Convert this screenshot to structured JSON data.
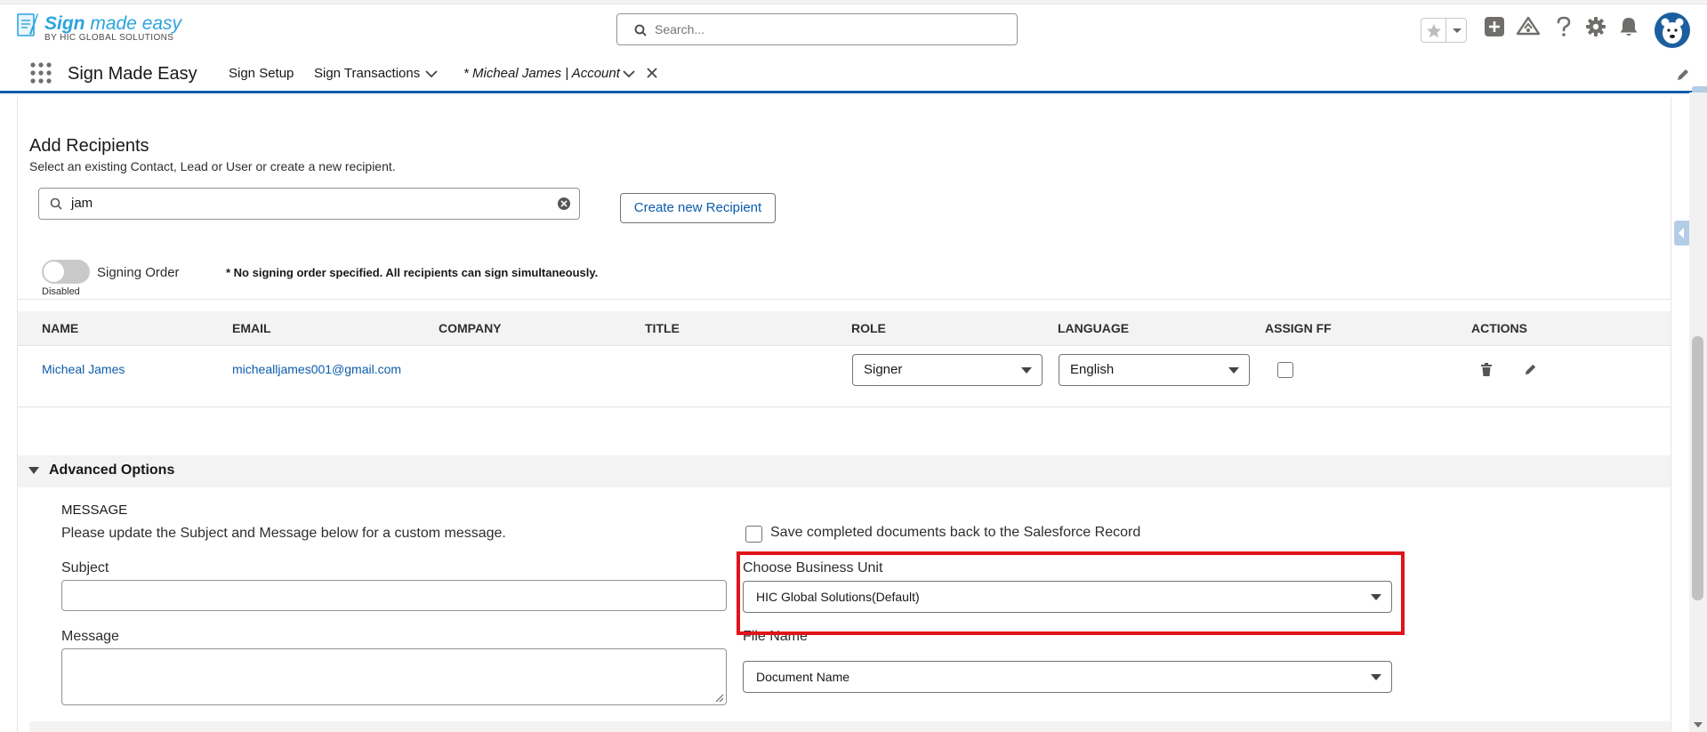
{
  "header": {
    "logo_title_bold": "Sign",
    "logo_title_rest": " made easy",
    "logo_subtitle": "BY HIC GLOBAL SOLUTIONS",
    "search_placeholder": "Search..."
  },
  "nav": {
    "app_name": "Sign Made Easy",
    "items": [
      {
        "label": "Sign Setup"
      },
      {
        "label": "Sign Transactions"
      },
      {
        "label": "* Micheal James | Account"
      }
    ]
  },
  "recipients": {
    "title": "Add Recipients",
    "subtitle": "Select an existing Contact, Lead or User or create a new recipient.",
    "search_value": "jam",
    "create_button": "Create new Recipient",
    "signing_order_label": "Signing Order",
    "signing_order_state": "Disabled",
    "signing_order_note": "* No signing order specified. All recipients can sign simultaneously."
  },
  "table": {
    "columns": [
      "NAME",
      "EMAIL",
      "COMPANY",
      "TITLE",
      "ROLE",
      "LANGUAGE",
      "ASSIGN FF",
      "ACTIONS"
    ],
    "rows": [
      {
        "name": "Micheal James",
        "email": "michealljames001@gmail.com",
        "company": "",
        "title": "",
        "role": "Signer",
        "language": "English",
        "assign_ff": false
      }
    ]
  },
  "advanced": {
    "title": "Advanced Options",
    "message_heading": "MESSAGE",
    "message_sub": "Please update the Subject and Message below for a custom message.",
    "save_back_label": "Save completed documents back to the Salesforce Record",
    "subject_label": "Subject",
    "subject_value": "",
    "message_label": "Message",
    "message_value": "",
    "business_unit_label": "Choose Business Unit",
    "business_unit_value": "HIC Global Solutions(Default)",
    "file_name_label": "File Name",
    "file_name_value": "Document Name"
  },
  "colors": {
    "brand_blue": "#0b5cab",
    "logo_blue": "#2ba4dd",
    "highlight_red": "#e0141a"
  },
  "icons": [
    "search-icon",
    "favorites-star-icon",
    "add-icon",
    "trailhead-icon",
    "help-icon",
    "setup-gear-icon",
    "notifications-bell-icon",
    "app-launcher-icon",
    "chevron-down-icon",
    "close-icon",
    "edit-pencil-icon",
    "clear-icon",
    "delete-icon"
  ]
}
